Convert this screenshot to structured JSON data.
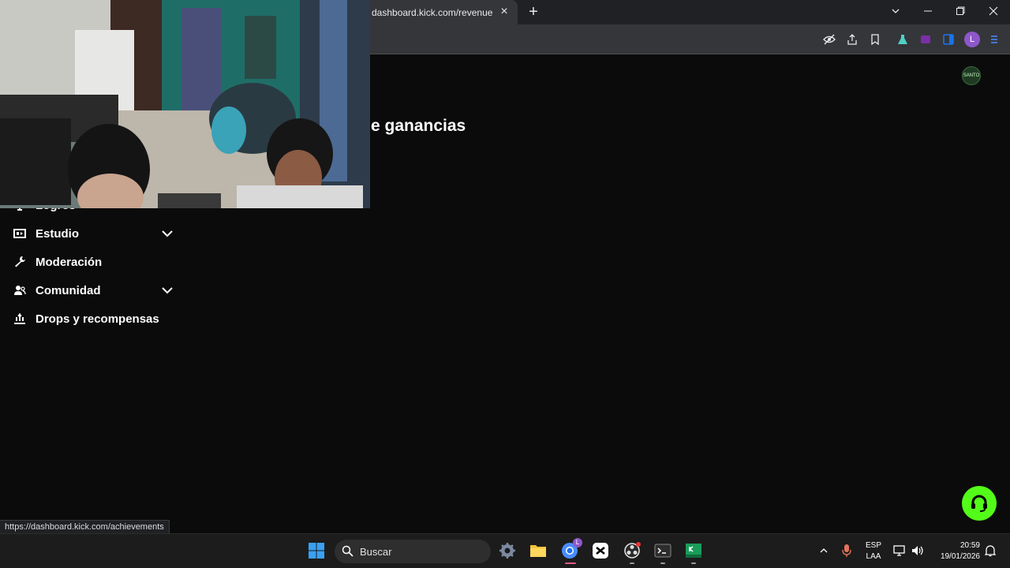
{
  "browser": {
    "tab_title": "dashboard.kick.com/revenue",
    "tab_close": "×",
    "new_tab": "+",
    "profile_initial": "L"
  },
  "page": {
    "title": "e ganancias",
    "channel_avatar_text": "SANTO"
  },
  "sidebar": {
    "items": [
      {
        "label": "Logros",
        "icon": "trophy-icon",
        "expandable": false
      },
      {
        "label": "Estudio",
        "icon": "studio-icon",
        "expandable": true
      },
      {
        "label": "Moderación",
        "icon": "wrench-icon",
        "expandable": false
      },
      {
        "label": "Comunidad",
        "icon": "users-icon",
        "expandable": true
      },
      {
        "label": "Drops y recompensas",
        "icon": "drops-icon",
        "expandable": false
      }
    ]
  },
  "status_bar": {
    "url": "https://dashboard.kick.com/achievements"
  },
  "taskbar": {
    "search_placeholder": "Buscar",
    "lang_line1": "ESP",
    "lang_line2": "LAA",
    "time": "20:59",
    "date": "19/01/2026",
    "chrome_badge": "L"
  },
  "colors": {
    "kick_green": "#53fc18",
    "page_bg": "#0b0b0c",
    "chrome_dark": "#202124",
    "chrome_toolbar": "#35363a"
  }
}
